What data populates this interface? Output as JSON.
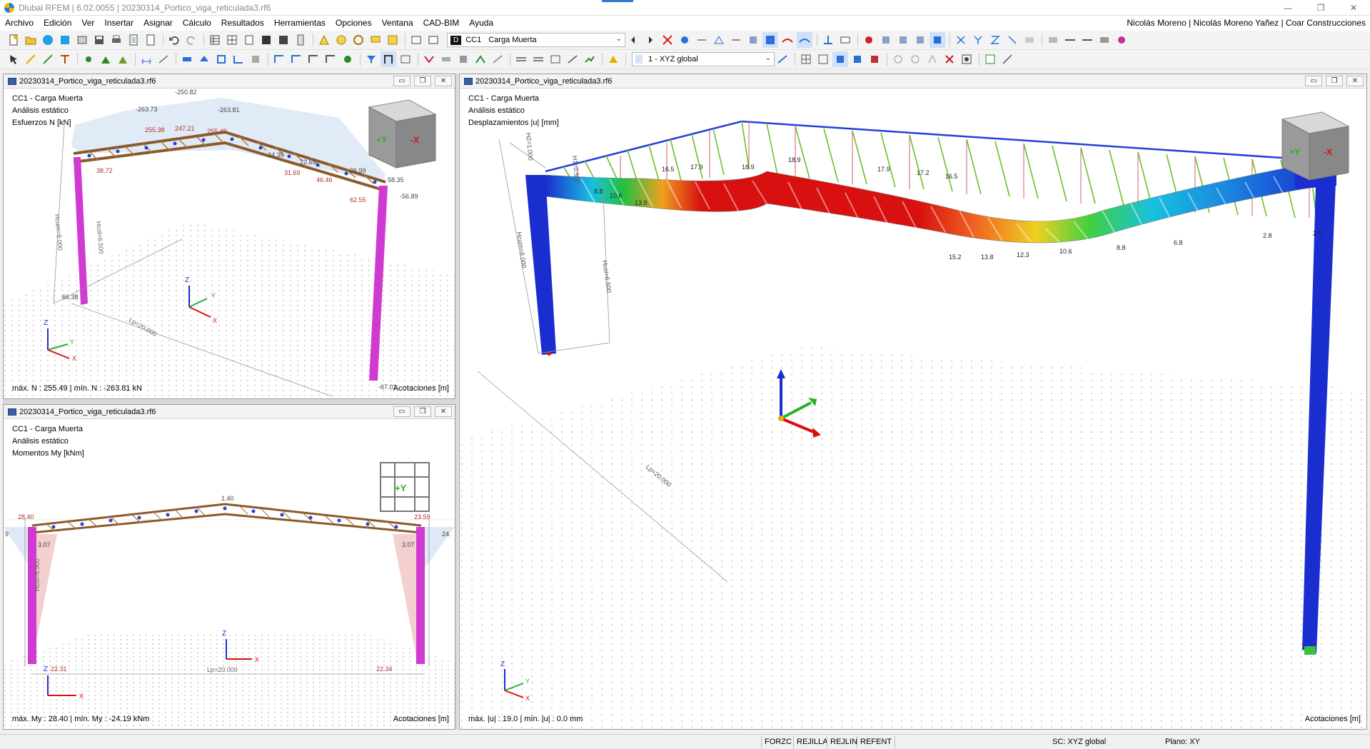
{
  "window": {
    "title": "Dlubal RFEM | 6.02.0055 | 20230314_Portico_viga_reticulada3.rf6",
    "minimize": "—",
    "maximize": "❐",
    "close": "✕"
  },
  "menu": {
    "items": [
      "Archivo",
      "Edición",
      "Ver",
      "Insertar",
      "Asignar",
      "Cálculo",
      "Resultados",
      "Herramientas",
      "Opciones",
      "Ventana",
      "CAD-BIM",
      "Ayuda"
    ],
    "user": "Nicolás Moreno | Nicolás Moreno Yañez | Coar Construcciones"
  },
  "toolbar": {
    "loadcase_badge": "D",
    "loadcase_code": "CC1",
    "loadcase_name": "Carga Muerta",
    "coord_system": "1 - XYZ global"
  },
  "panes": {
    "top_left": {
      "file": "20230314_Portico_viga_reticulada3.rf6",
      "line1": "CC1 - Carga Muerta",
      "line2": "Análisis estático",
      "line3": "Esfuerzos N [kN]",
      "footer_left": "máx. N : 255.49 | mín. N : -263.81 kN",
      "footer_right": "Acotaciones [m]",
      "labels": {
        "a": "-263.73",
        "b": "-250.82",
        "c": "-263.81",
        "d": "255.38",
        "e": "247.21",
        "f": "255.49",
        "g": "38.72",
        "h": "31.69",
        "i": "46.46",
        "j": "62.55",
        "k": "-56.89",
        "l": "58.35",
        "m": "66.38",
        "n": "-67.01",
        "o": "22.65",
        "p": "26.99",
        "q": "24.35",
        "hcum": "Hcum=8.000",
        "hcol": "Hcol=6.500",
        "lp": "Lp=20.000"
      },
      "cube_left": "+Y",
      "cube_right": "-X"
    },
    "bottom_left": {
      "file": "20230314_Portico_viga_reticulada3.rf6",
      "line1": "CC1 - Carga Muerta",
      "line2": "Análisis estático",
      "line3": "Momentos My [kNm]",
      "footer_left": "máx. My : 28.40 | mín. My : -24.19 kNm",
      "footer_right": "Acotaciones [m]",
      "labels": {
        "a": "1.40",
        "b": "28.40",
        "c": "23.59",
        "d": "3.07",
        "e": "3.07",
        "f": "22.31",
        "g": "22.34",
        "hcol": "Hcol=6.500",
        "lp": "Lp=20.000",
        "left9": "9",
        "right24": "24."
      },
      "cube_label": "+Y"
    },
    "right": {
      "file": "20230314_Portico_viga_reticulada3.rf6",
      "line1": "CC1 - Carga Muerta",
      "line2": "Análisis estático",
      "line3": "Desplazamientos |u| [mm]",
      "footer_left": "máx. |u| : 19.0 | mín. |u| : 0.0 mm",
      "footer_right": "Acotaciones [m]",
      "labels": {
        "h2": "H2=1.000",
        "h1": "H1=0.500",
        "hcum": "Hcum=8.000",
        "hcol": "Hcol=6.500",
        "lp": "Lp=20.000",
        "d1": "16.5",
        "d2": "17.9",
        "d3": "18.9",
        "d4": "18.9",
        "d5": "17.9",
        "d6": "17.2",
        "d7": "16.5",
        "d8": "15.2",
        "d9": "13.8",
        "d10": "12.3",
        "d11": "10.6",
        "d12": "8.8",
        "d13": "6.8",
        "d14": "2.8",
        "d15": "2.0",
        "d16": "10.6",
        "d17": "13.9",
        "d18": "8.8"
      },
      "cube_left": "+Y",
      "cube_right": "-X"
    }
  },
  "status": {
    "forzc": "FORZC",
    "rejilla": "REJILLA",
    "rejlin": "REJLIN",
    "refent": "REFENT",
    "sc": "SC: XYZ global",
    "plano": "Plano: XY"
  },
  "colors": {
    "column_magenta": "#d03ad0",
    "truss_brown": "#8a5a2a",
    "node_blue": "#2340d8",
    "hot_red": "#d81010",
    "cold_blue": "#1a2ed0",
    "green": "#2ab02a"
  }
}
